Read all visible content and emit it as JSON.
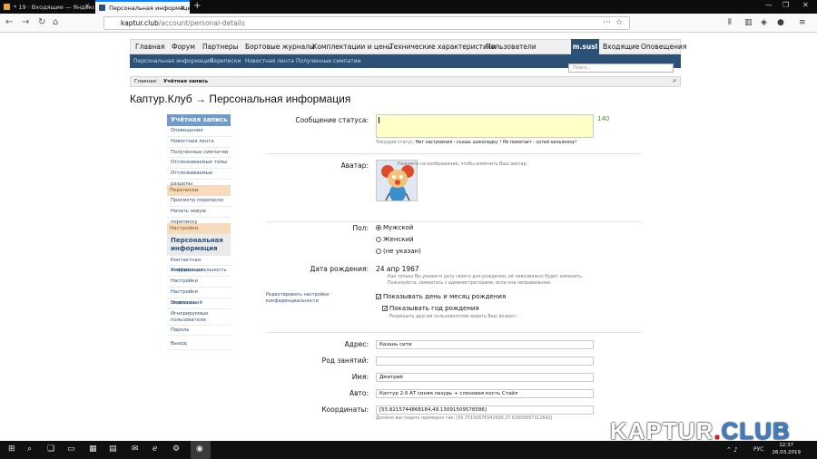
{
  "browser": {
    "tabs": [
      {
        "label": "* 19 · Входящие — Яндекс.По"
      },
      {
        "label": "Персональная информация"
      }
    ],
    "url_host": "kaptur.club",
    "url_path": "/account/personal-details"
  },
  "site": {
    "topnav": [
      "Главная",
      "Форум",
      "Партнеры",
      "Бортовые журналы",
      "Комплектации и цены",
      "Технические характеристики",
      "Пользователи"
    ],
    "user": "m.susl",
    "inbox": "Входящие",
    "alerts": "Оповещения",
    "subnav": [
      "Персональная информация",
      "Переписки",
      "Новостная лента",
      "Полученные симпатии"
    ],
    "search_placeholder": "Поиск...",
    "crumbs": [
      "Главная",
      "Учётная запись"
    ],
    "title": "Каптур.Клуб → Персональная информация"
  },
  "sidebar": {
    "account_head": "Учётная запись",
    "account_items": [
      "Оповещения",
      "Новостная лента",
      "Полученные симпатии",
      "Отслеживаемые темы",
      "Отслеживаемые разделы"
    ],
    "conv_head": "Переписки",
    "conv_items": [
      "Просмотр переписок",
      "Начать новую переписку"
    ],
    "settings_head": "Настройки",
    "selected": "Персональная информация",
    "settings_items": [
      "Контактная информация",
      "Конфиденциальность",
      "Настройки",
      "Настройки оповещений",
      "Подписка",
      "Игнорируемые пользователи",
      "Пароль"
    ],
    "logout": "Выход"
  },
  "form": {
    "status_label": "Сообщение статуса:",
    "status_counter": "140",
    "status_current_prefix": "Текущий статус:",
    "status_current": "Нет настроения - съешь шоколадку ! Не помогает - сотей кильянону!",
    "avatar_label": "Аватар:",
    "avatar_hint": "Нажмите на изображение, чтобы изменить Ваш аватар.",
    "gender_label": "Пол:",
    "gender_options": [
      "Мужской",
      "Женский",
      "(не указан)"
    ],
    "dob_label": "Дата рождения:",
    "dob_value": "24 апр 1967",
    "dob_hint": "Как только Вы укажете дату своего дня рождения, её невозможно будет изменить. Пожалуйста, свяжитесь с администраторами, если она неправильная.",
    "privacy_link": "Редактировать настройки конфиденциальности",
    "show_day_month": "Показывать день и месяц рождения",
    "show_year": "Показывать год рождения",
    "show_year_hint": "Разрешить другим пользователям видеть Ваш возраст.",
    "address_label": "Адрес:",
    "address_value": "Казань сити",
    "occupation_label": "Род занятий:",
    "occupation_value": "",
    "name_label": "Имя:",
    "name_value": "Дмитрий",
    "car_label": "Авто:",
    "car_value": "Каптур 2.0 АТ  синяя лазурь + слоновая кость Стайл",
    "coords_label": "Координаты:",
    "coords_value": "[55.8215744868184,49.13091509578586]",
    "coords_hint": "Должно выглядеть примерно так: [55.75150676542690,37.61850697312642]"
  },
  "taskbar": {
    "time": "12:37",
    "date": "26.03.2019",
    "lang": "РУС"
  },
  "watermark": {
    "a": "KAPTUR",
    "b": ".",
    "c": "CLUB"
  }
}
